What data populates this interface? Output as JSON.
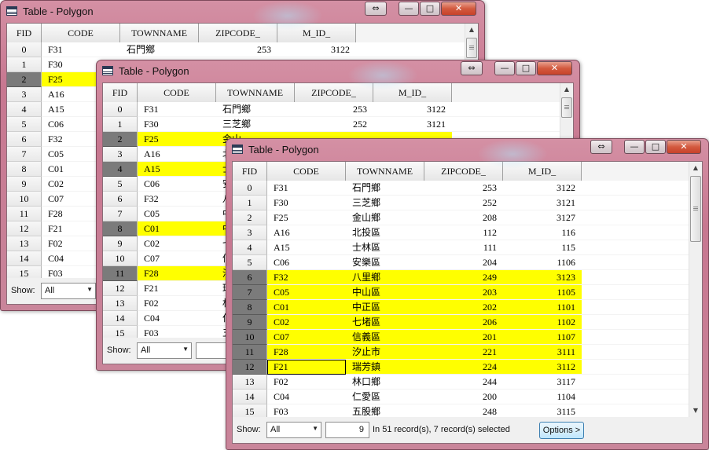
{
  "window_title": "Table - Polygon",
  "title_buttons": {
    "swap": "⇔",
    "minimize": "—",
    "maximize": "□",
    "close": "✕"
  },
  "columns": [
    "FID",
    "CODE",
    "TOWNNAME",
    "ZIPCODE_",
    "M_ID_"
  ],
  "scroll": {
    "up": "▲",
    "down": "▼"
  },
  "footer": {
    "show_label": "Show:",
    "show_value": "All",
    "combo_arrow": "▼",
    "record_number": "9",
    "status": "In 51 record(s), 7 record(s) selected",
    "options_label": "Options >"
  },
  "records": [
    {
      "fid": "0",
      "code": "F31",
      "town": "石門鄉",
      "zip": "253",
      "mid": "3122"
    },
    {
      "fid": "1",
      "code": "F30",
      "town": "三芝鄉",
      "zip": "252",
      "mid": "3121"
    },
    {
      "fid": "2",
      "code": "F25",
      "town": "金山鄉",
      "zip": "208",
      "mid": "3127"
    },
    {
      "fid": "3",
      "code": "A16",
      "town": "北投區",
      "zip": "112",
      "mid": "116"
    },
    {
      "fid": "4",
      "code": "A15",
      "town": "士林區",
      "zip": "111",
      "mid": "115"
    },
    {
      "fid": "5",
      "code": "C06",
      "town": "安樂區",
      "zip": "204",
      "mid": "1106"
    },
    {
      "fid": "6",
      "code": "F32",
      "town": "八里鄉",
      "zip": "249",
      "mid": "3123"
    },
    {
      "fid": "7",
      "code": "C05",
      "town": "中山區",
      "zip": "203",
      "mid": "1105"
    },
    {
      "fid": "8",
      "code": "C01",
      "town": "中正區",
      "zip": "202",
      "mid": "1101"
    },
    {
      "fid": "9",
      "code": "C02",
      "town": "七堵區",
      "zip": "206",
      "mid": "1102"
    },
    {
      "fid": "10",
      "code": "C07",
      "town": "信義區",
      "zip": "201",
      "mid": "1107"
    },
    {
      "fid": "11",
      "code": "F28",
      "town": "汐止市",
      "zip": "221",
      "mid": "3111"
    },
    {
      "fid": "12",
      "code": "F21",
      "town": "瑞芳鎮",
      "zip": "224",
      "mid": "3112"
    },
    {
      "fid": "13",
      "code": "F02",
      "town": "林口鄉",
      "zip": "244",
      "mid": "3117"
    },
    {
      "fid": "14",
      "code": "C04",
      "town": "仁愛區",
      "zip": "200",
      "mid": "1104"
    },
    {
      "fid": "15",
      "code": "F03",
      "town": "五股鄉",
      "zip": "248",
      "mid": "3115"
    }
  ],
  "windows": [
    {
      "id": "back",
      "selected_fids": [
        "2"
      ],
      "focus_fid": null,
      "visible_town_text": {
        "0": "石門鄉"
      },
      "visible_num_rows": [
        "0"
      ],
      "visible_mid_rows": [
        "0"
      ],
      "show_numbox": false,
      "show_status": false,
      "show_options": false
    },
    {
      "id": "middle",
      "selected_fids": [
        "2",
        "4",
        "8",
        "11"
      ],
      "focus_fid": null,
      "visible_town_text": {
        "0": "石門鄉",
        "1": "三芝鄉",
        "2": "金山",
        "3": "北",
        "4": "士",
        "5": "安",
        "6": "八",
        "7": "中",
        "8": "中",
        "9": "七",
        "10": "信",
        "11": "汐",
        "12": "瑞",
        "13": "林",
        "14": "仁",
        "15": "五"
      },
      "visible_num_rows": [
        "0",
        "1"
      ],
      "visible_mid_rows": [
        "0",
        "1"
      ],
      "show_numbox": true,
      "show_status": false,
      "show_options": false
    },
    {
      "id": "front",
      "selected_fids": [
        "6",
        "7",
        "8",
        "9",
        "10",
        "11",
        "12"
      ],
      "focus_fid": "12",
      "visible_town_text": null,
      "visible_num_rows": null,
      "visible_mid_rows": null,
      "show_numbox": true,
      "show_status": true,
      "show_options": true
    }
  ]
}
